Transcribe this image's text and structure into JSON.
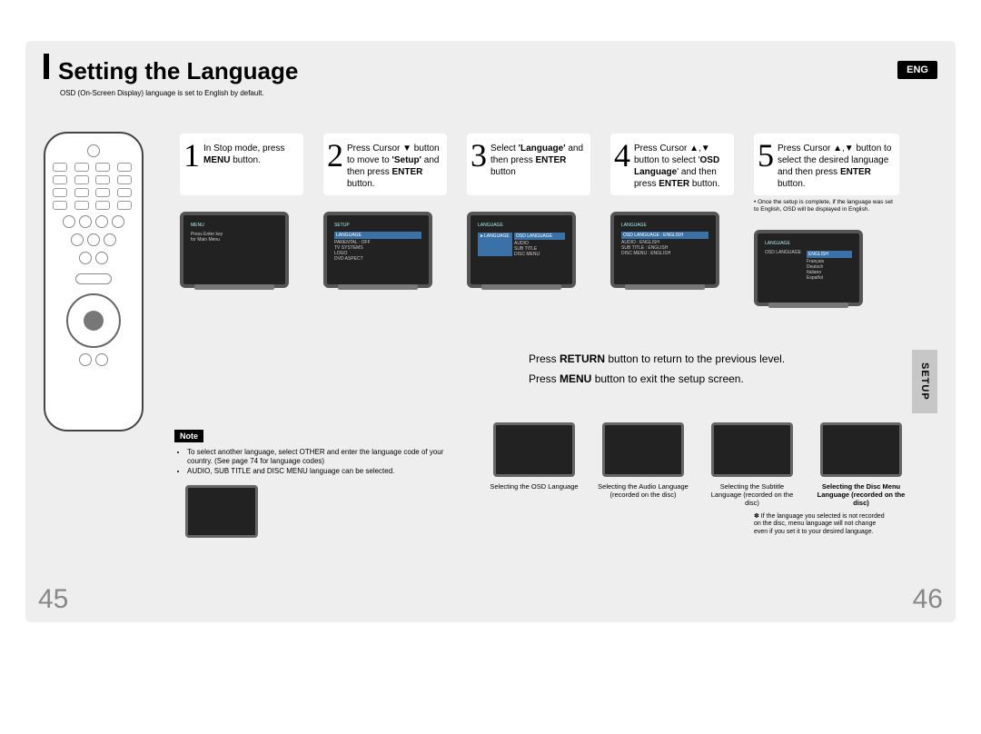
{
  "header": {
    "title": "Setting the Language",
    "lang_badge": "ENG",
    "subtitle": "OSD (On-Screen Display) language is set to English by default."
  },
  "steps": [
    {
      "num": "1",
      "html": "In Stop mode, press <b>MENU</b> button."
    },
    {
      "num": "2",
      "html": "Press Cursor ▼ button to move to <b>'Setup'</b> and then press <b>ENTER</b> button."
    },
    {
      "num": "3",
      "html": "Select <b>'Language'</b> and then press <b>ENTER</b> button"
    },
    {
      "num": "4",
      "html": "Press Cursor ▲,▼ button to select '<b>OSD Language</b>' and then press <b>ENTER</b> button."
    },
    {
      "num": "5",
      "html": "Press Cursor ▲,▼ button to select the desired language and then press <b>ENTER</b> button.",
      "note": "• Once the setup is complete, if the language was set to English, OSD will be displayed in English."
    }
  ],
  "tv_menus": {
    "s1": {
      "title": "MENU",
      "lines": [
        "Press Enter key",
        "for Main Menu"
      ]
    },
    "s2": {
      "title": "SETUP",
      "lines": [
        "LANGUAGE",
        "PARENTAL : OFF",
        "TV SYSTEMS",
        "LOGO",
        "DVD ASPECT"
      ]
    },
    "s3": {
      "title": "LANGUAGE",
      "sidebar": "►LANGUAGE",
      "lines": [
        "OSD LANGUAGE",
        "AUDIO",
        "SUB TITLE",
        "DISC MENU"
      ]
    },
    "s4": {
      "title": "LANGUAGE",
      "lines": [
        "OSD LANGUAGE : ENGLISH",
        "AUDIO : ENGLISH",
        "SUB TITLE : ENGLISH",
        "DISC MENU : ENGLISH"
      ]
    },
    "s5": {
      "title": "LANGUAGE",
      "options": [
        "ENGLISH",
        "Français",
        "Deutsch",
        "Italiano",
        "Español"
      ]
    }
  },
  "return_box": {
    "line1_a": "Press ",
    "line1_b": "RETURN",
    "line1_c": " button to return to the previous level.",
    "line2_a": "Press ",
    "line2_b": "MENU",
    "line2_c": " button to exit the setup screen."
  },
  "setup_tab": "SETUP",
  "note": {
    "badge": "Note",
    "items": [
      "To select another language, select OTHER and enter the language code of your country. (See page 74 for language codes)",
      "AUDIO, SUB TITLE and DISC MENU language can be selected."
    ]
  },
  "thumbs": [
    {
      "caption": "Selecting the OSD Language",
      "bold": false
    },
    {
      "caption": "Selecting the Audio Language (recorded on the disc)",
      "bold": false
    },
    {
      "caption": "Selecting the Subtitle Language (recorded on the disc)",
      "bold": false
    },
    {
      "caption": "Selecting the Disc Menu Language (recorded on the disc)",
      "bold": true
    }
  ],
  "disclaimer": "✽ If the language you selected is not recorded on the disc, menu language will not change even if you set it to your desired language.",
  "page_left": "45",
  "page_right": "46"
}
